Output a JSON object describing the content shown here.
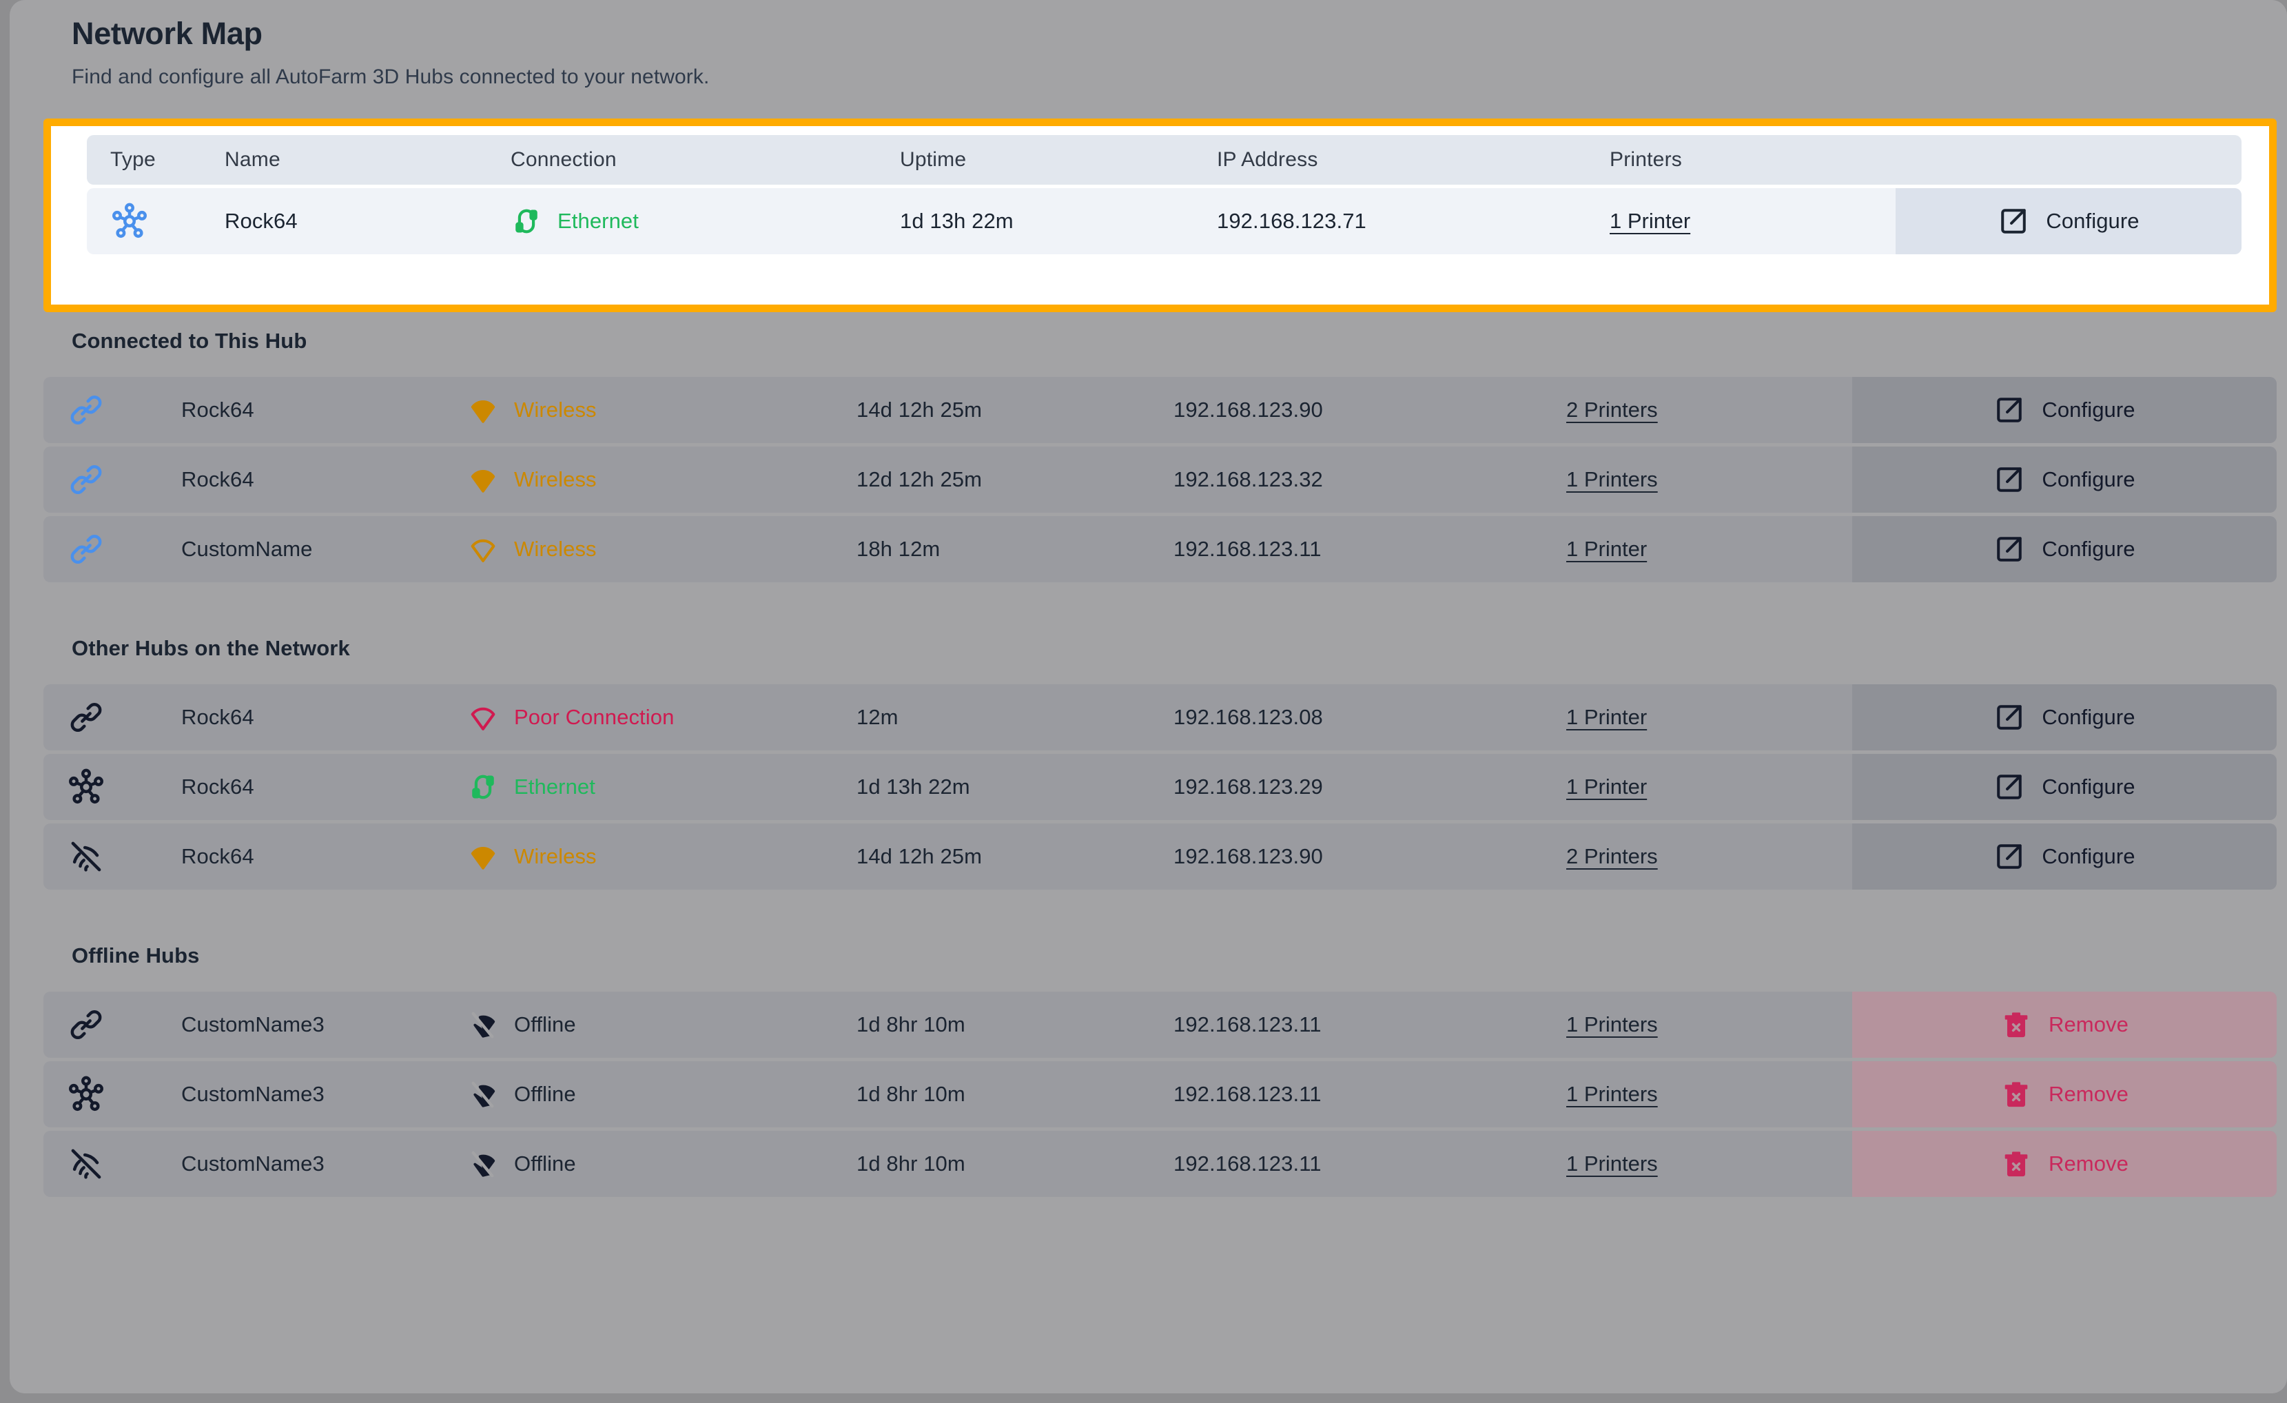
{
  "header": {
    "title": "Network Map",
    "subtitle": "Find and configure all AutoFarm 3D Hubs connected to your network."
  },
  "columns": {
    "type": "Type",
    "name": "Name",
    "connection": "Connection",
    "uptime": "Uptime",
    "ip_address": "IP Address",
    "printers": "Printers"
  },
  "actions": {
    "configure": "Configure",
    "remove": "Remove"
  },
  "colors": {
    "highlight_border": "#ffab00",
    "ethernet": "#1fb95c",
    "wireless": "#cc8800",
    "poor": "#d01a50",
    "remove": "#c9285c",
    "type_icon_active": "#4a90ec",
    "page_background": "#a3a3a5"
  },
  "this_hub": {
    "row": {
      "type_icon": "network-hub-icon",
      "name": "Rock64",
      "connection_icon": "ethernet-cable-icon",
      "connection": "Ethernet",
      "connection_state": "ethernet",
      "uptime": "1d 13h 22m",
      "ip": "192.168.123.71",
      "printers": "1 Printer",
      "action": "Configure"
    }
  },
  "sections": [
    {
      "id": "connected-to-this-hub",
      "heading": "Connected to This Hub",
      "action_type": "configure",
      "rows": [
        {
          "type_icon": "link-icon",
          "type_icon_color": "#4a90ec",
          "name": "Rock64",
          "connection_icon": "wifi-strong-icon",
          "connection": "Wireless",
          "connection_state": "wireless",
          "uptime": "14d 12h 25m",
          "ip": "192.168.123.90",
          "printers": "2 Printers",
          "action": "Configure"
        },
        {
          "type_icon": "link-icon",
          "type_icon_color": "#4a90ec",
          "name": "Rock64",
          "connection_icon": "wifi-strong-icon",
          "connection": "Wireless",
          "connection_state": "wireless",
          "uptime": "12d 12h 25m",
          "ip": "192.168.123.32",
          "printers": "1 Printers",
          "action": "Configure"
        },
        {
          "type_icon": "link-icon",
          "type_icon_color": "#4a90ec",
          "name": "CustomName",
          "connection_icon": "wifi-weak-icon",
          "connection": "Wireless",
          "connection_state": "wireless",
          "uptime": "18h 12m",
          "ip": "192.168.123.11",
          "printers": "1 Printer",
          "action": "Configure"
        }
      ]
    },
    {
      "id": "other-hubs-on-the-network",
      "heading": "Other Hubs on the Network",
      "action_type": "configure",
      "rows": [
        {
          "type_icon": "link-icon",
          "type_icon_color": "#13192a",
          "name": "Rock64",
          "connection_icon": "wifi-weak-icon",
          "connection": "Poor Connection",
          "connection_state": "poor",
          "uptime": "12m",
          "ip": "192.168.123.08",
          "printers": "1 Printer",
          "action": "Configure"
        },
        {
          "type_icon": "network-hub-icon",
          "type_icon_color": "#13192a",
          "name": "Rock64",
          "connection_icon": "ethernet-cable-icon",
          "connection": "Ethernet",
          "connection_state": "ethernet",
          "uptime": "1d 13h 22m",
          "ip": "192.168.123.29",
          "printers": "1 Printer",
          "action": "Configure"
        },
        {
          "type_icon": "wireless-off-icon",
          "type_icon_color": "#13192a",
          "name": "Rock64",
          "connection_icon": "wifi-strong-icon",
          "connection": "Wireless",
          "connection_state": "wireless",
          "uptime": "14d 12h 25m",
          "ip": "192.168.123.90",
          "printers": "2 Printers",
          "action": "Configure"
        }
      ]
    },
    {
      "id": "offline-hubs",
      "heading": "Offline Hubs",
      "action_type": "remove",
      "rows": [
        {
          "type_icon": "link-icon",
          "type_icon_color": "#13192a",
          "name": "CustomName3",
          "connection_icon": "wifi-off-icon",
          "connection": "Offline",
          "connection_state": "offline",
          "uptime": "1d 8hr 10m",
          "ip": "192.168.123.11",
          "printers": "1 Printers",
          "action": "Remove"
        },
        {
          "type_icon": "network-hub-icon",
          "type_icon_color": "#13192a",
          "name": "CustomName3",
          "connection_icon": "wifi-off-icon",
          "connection": "Offline",
          "connection_state": "offline",
          "uptime": "1d 8hr 10m",
          "ip": "192.168.123.11",
          "printers": "1 Printers",
          "action": "Remove"
        },
        {
          "type_icon": "wireless-off-icon",
          "type_icon_color": "#13192a",
          "name": "CustomName3",
          "connection_icon": "wifi-off-icon",
          "connection": "Offline",
          "connection_state": "offline",
          "uptime": "1d 8hr 10m",
          "ip": "192.168.123.11",
          "printers": "1 Printers",
          "action": "Remove"
        }
      ]
    }
  ]
}
